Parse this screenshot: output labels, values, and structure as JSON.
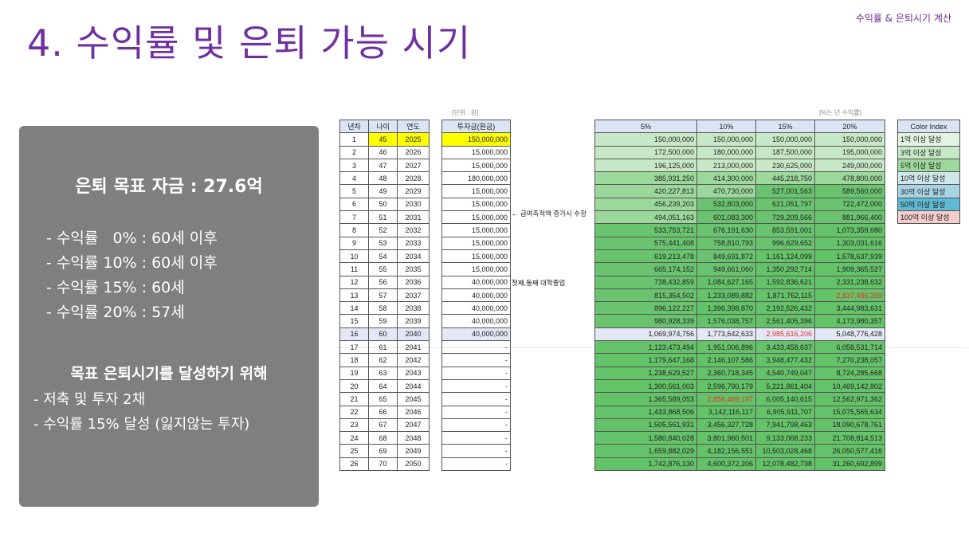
{
  "header": {
    "title": "4. 수익률 및 은퇴 가능 시기",
    "corner_label": "수익률 & 은퇴시기 계산"
  },
  "panel": {
    "goal": "은퇴 목표 자금 : 27.6억",
    "rates": [
      "- 수익률   0% : 60세 이후",
      "- 수익률 10% : 60세 이후",
      "- 수익률 15% : 60세",
      "- 수익률 20% : 57세"
    ],
    "plan_title": "목표 은퇴시기를 달성하기 위해",
    "steps": [
      "- 저축 및 투자 2채",
      "- 수익률 15% 달성 (잃지않는 투자)"
    ]
  },
  "sheet": {
    "unit_note": "[단위 : 원]",
    "rate_note": "[%는 년 수익률]",
    "left_headers": [
      "년차",
      "나이",
      "연도"
    ],
    "invest_header": "투자금(원금)",
    "rate_headers": [
      "5%",
      "10%",
      "15%",
      "20%"
    ],
    "annotations": [
      "← 급여축적액 증가시 수정",
      "첫째,둘째 대학졸업"
    ],
    "rows": [
      [
        "1",
        "45",
        "2025",
        "150,000,000",
        "150,000,000",
        "150,000,000",
        "150,000,000",
        "150,000,000"
      ],
      [
        "2",
        "46",
        "2026",
        "15,000,000",
        "172,500,000",
        "180,000,000",
        "187,500,000",
        "195,000,000"
      ],
      [
        "3",
        "47",
        "2027",
        "15,000,000",
        "196,125,000",
        "213,000,000",
        "230,625,000",
        "249,000,000"
      ],
      [
        "4",
        "48",
        "2028",
        "180,000,000",
        "385,931,250",
        "414,300,000",
        "445,218,750",
        "478,800,000"
      ],
      [
        "5",
        "49",
        "2029",
        "15,000,000",
        "420,227,813",
        "470,730,000",
        "527,001,563",
        "589,560,000"
      ],
      [
        "6",
        "50",
        "2030",
        "15,000,000",
        "456,239,203",
        "532,803,000",
        "621,051,797",
        "722,472,000"
      ],
      [
        "7",
        "51",
        "2031",
        "15,000,000",
        "494,051,163",
        "601,083,300",
        "729,209,566",
        "881,966,400"
      ],
      [
        "8",
        "52",
        "2032",
        "15,000,000",
        "533,753,721",
        "676,191,630",
        "853,591,001",
        "1,073,359,680"
      ],
      [
        "9",
        "53",
        "2033",
        "15,000,000",
        "575,441,408",
        "758,810,793",
        "996,629,652",
        "1,303,031,616"
      ],
      [
        "10",
        "54",
        "2034",
        "15,000,000",
        "619,213,478",
        "849,691,872",
        "1,161,124,099",
        "1,578,637,939"
      ],
      [
        "11",
        "55",
        "2035",
        "15,000,000",
        "665,174,152",
        "949,661,060",
        "1,350,292,714",
        "1,909,365,527"
      ],
      [
        "12",
        "56",
        "2036",
        "40,000,000",
        "738,432,859",
        "1,084,627,165",
        "1,592,836,621",
        "2,331,238,632"
      ],
      [
        "13",
        "57",
        "2037",
        "40,000,000",
        "815,354,502",
        "1,233,089,882",
        "1,871,762,115",
        "2,837,486,359"
      ],
      [
        "14",
        "58",
        "2038",
        "40,000,000",
        "896,122,227",
        "1,396,398,870",
        "2,192,526,432",
        "3,444,983,631"
      ],
      [
        "15",
        "59",
        "2039",
        "40,000,000",
        "980,928,339",
        "1,576,038,757",
        "2,561,405,396",
        "4,173,980,357"
      ],
      [
        "16",
        "60",
        "2040",
        "40,000,000",
        "1,069,974,756",
        "1,773,642,633",
        "2,985,616,206",
        "5,048,776,428"
      ],
      [
        "17",
        "61",
        "2041",
        "-",
        "1,123,473,494",
        "1,951,006,896",
        "3,433,458,637",
        "6,058,531,714"
      ],
      [
        "18",
        "62",
        "2042",
        "-",
        "1,179,647,168",
        "2,146,107,586",
        "3,948,477,432",
        "7,270,238,057"
      ],
      [
        "19",
        "63",
        "2043",
        "-",
        "1,238,629,527",
        "2,360,718,345",
        "4,540,749,047",
        "8,724,285,668"
      ],
      [
        "20",
        "64",
        "2044",
        "-",
        "1,300,561,003",
        "2,596,790,179",
        "5,221,861,404",
        "10,469,142,802"
      ],
      [
        "21",
        "65",
        "2045",
        "-",
        "1,365,589,053",
        "2,856,469,197",
        "6,005,140,615",
        "12,562,971,362"
      ],
      [
        "22",
        "66",
        "2046",
        "-",
        "1,433,868,506",
        "3,142,116,117",
        "6,905,911,707",
        "15,075,565,634"
      ],
      [
        "23",
        "67",
        "2047",
        "-",
        "1,505,561,931",
        "3,456,327,728",
        "7,941,798,463",
        "18,090,678,761"
      ],
      [
        "24",
        "68",
        "2048",
        "-",
        "1,580,840,028",
        "3,801,960,501",
        "9,133,068,233",
        "21,708,814,513"
      ],
      [
        "25",
        "69",
        "2049",
        "-",
        "1,659,882,029",
        "4,182,156,551",
        "10,503,028,468",
        "26,050,577,416"
      ],
      [
        "26",
        "70",
        "2050",
        "-",
        "1,742,876,130",
        "4,600,372,206",
        "12,078,482,738",
        "31,260,692,899"
      ]
    ],
    "color_index": {
      "header": "Color Index",
      "items": [
        "1억 이상 달성",
        "3억 이상 달성",
        "5억 이상 달성",
        "10억 이상 달성",
        "30억 이상 달성",
        "50억 이상 달성",
        "100억 이상 달성"
      ]
    }
  }
}
